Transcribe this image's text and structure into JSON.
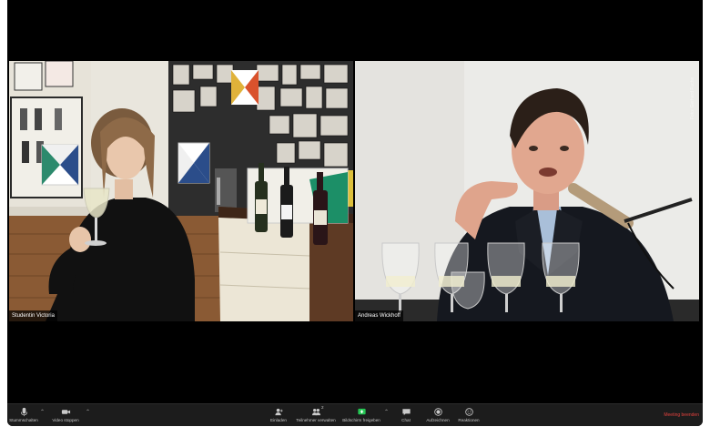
{
  "participants": {
    "left": {
      "name": "Studentin Victoria"
    },
    "right": {
      "name": "Andreas Wickhoff",
      "watermark": "Foto: Gerhard Fuchs"
    }
  },
  "toolbar": {
    "mute": "Stummschalten",
    "video_stop": "Video stoppen",
    "invite": "Einladen",
    "participants": "Teilnehmer verwalten",
    "participants_count": "2",
    "share": "Bildschirm freigeben",
    "chat": "Chat",
    "record": "Aufzeichnen",
    "reactions": "Reaktionen",
    "end": "Meeting beenden"
  },
  "colors": {
    "share_accent": "#23c552",
    "end_accent": "#e2413d",
    "toolbar_bg": "#1c1c1c"
  }
}
